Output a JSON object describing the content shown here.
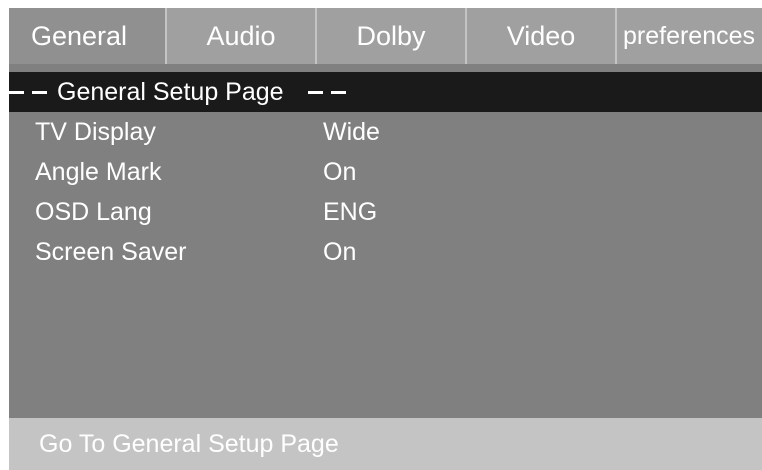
{
  "tabs": [
    {
      "label": "General",
      "active": true
    },
    {
      "label": "Audio",
      "active": false
    },
    {
      "label": "Dolby",
      "active": false
    },
    {
      "label": "Video",
      "active": false
    },
    {
      "label": "preferences",
      "active": false
    }
  ],
  "page_title": "General Setup Page",
  "settings": [
    {
      "label": "TV Display",
      "value": "Wide"
    },
    {
      "label": "Angle Mark",
      "value": "On"
    },
    {
      "label": "OSD Lang",
      "value": "ENG"
    },
    {
      "label": "Screen Saver",
      "value": "On"
    }
  ],
  "footer_hint": "Go To General Setup Page",
  "colors": {
    "screen_bg": "#808080",
    "tab_bg": "#a0a0a0",
    "title_bar_bg": "#1a1a1a",
    "footer_bg": "#c4c4c4",
    "text": "#ffffff"
  }
}
